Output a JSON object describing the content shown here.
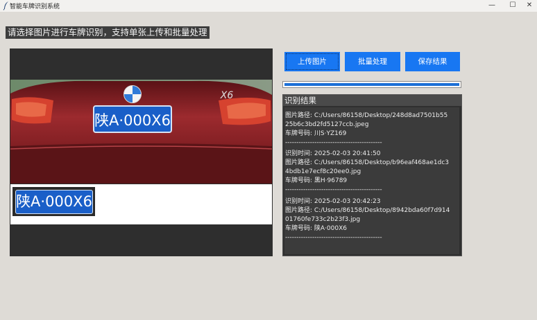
{
  "window": {
    "title": "智能车牌识别系统",
    "minimize_glyph": "—",
    "maximize_glyph": "☐",
    "close_glyph": "✕"
  },
  "instruction": "请选择图片进行车牌识别，支持单张上传和批量处理",
  "car_photo": {
    "plate_text": "陕A·000X6",
    "badge_text": "X6"
  },
  "crop": {
    "plate_text": "陕A·000X6"
  },
  "buttons": {
    "upload": "上传图片",
    "batch": "批量处理",
    "save": "保存结果"
  },
  "progress": {
    "value": 1.0
  },
  "results": {
    "title": "识别结果",
    "lines": [
      "图片路径: C:/Users/86158/Desktop/248d8ad7501b55",
      "25b6c3bd2fd5127ccb.jpeg",
      "车牌号码: 川S·YZ169",
      "-------------------------------------------",
      "识别时间: 2025-02-03 20:41:50",
      "图片路径: C:/Users/86158/Desktop/b96eaf468ae1dc3",
      "4bdb1e7ecf8c20ee0.jpg",
      "车牌号码: 黑H·96789",
      "-------------------------------------------",
      "识别时间: 2025-02-03 20:42:23",
      "图片路径: C:/Users/86158/Desktop/8942bda60f7d914",
      "01760fe733c2b23f3.jpg",
      "车牌号码: 陕A·000X6",
      "-------------------------------------------"
    ]
  },
  "colors": {
    "accent": "#1877f2",
    "panel": "#2e2e2e",
    "background": "#dedbd6"
  }
}
